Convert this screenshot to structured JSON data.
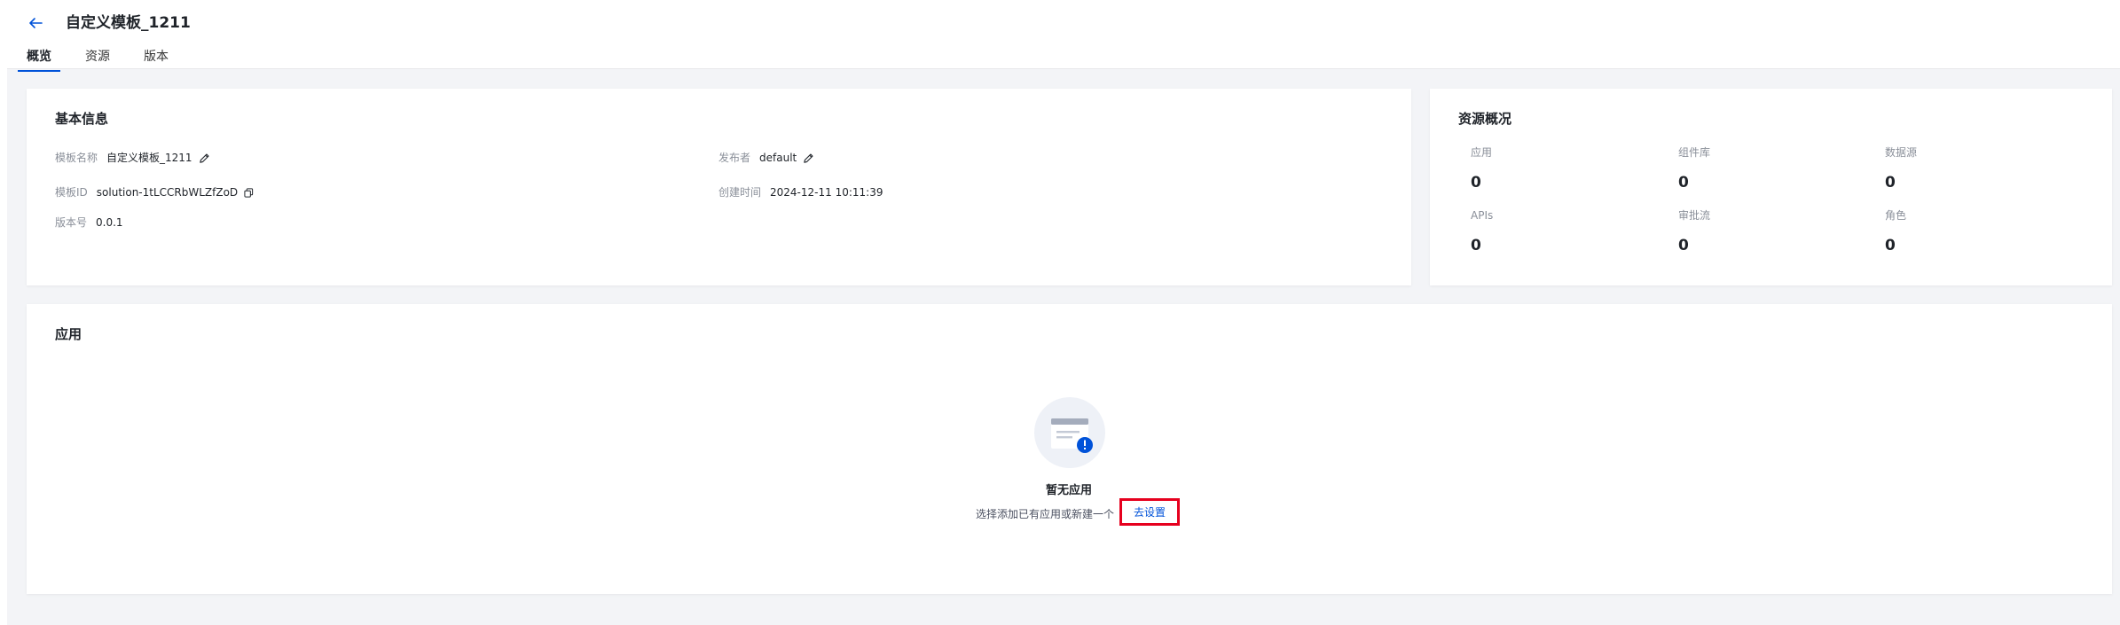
{
  "header": {
    "title": "自定义模板_1211",
    "tabs": [
      {
        "label": "概览"
      },
      {
        "label": "资源"
      },
      {
        "label": "版本"
      }
    ]
  },
  "basic_info": {
    "title": "基本信息",
    "template_name_label": "模板名称",
    "template_name_value": "自定义模板_1211",
    "publisher_label": "发布者",
    "publisher_value": "default",
    "template_id_label": "模板ID",
    "template_id_value": "solution-1tLCCRbWLZfZoD",
    "created_time_label": "创建时间",
    "created_time_value": "2024-12-11 10:11:39",
    "version_label": "版本号",
    "version_value": "0.0.1"
  },
  "resource_overview": {
    "title": "资源概况",
    "stats": [
      {
        "label": "应用",
        "value": "0"
      },
      {
        "label": "组件库",
        "value": "0"
      },
      {
        "label": "数据源",
        "value": "0"
      },
      {
        "label": "APIs",
        "value": "0"
      },
      {
        "label": "审批流",
        "value": "0"
      },
      {
        "label": "角色",
        "value": "0"
      }
    ]
  },
  "apps": {
    "title": "应用",
    "empty_title": "暂无应用",
    "empty_desc": "选择添加已有应用或新建一个",
    "setup_link": "去设置"
  },
  "colors": {
    "accent": "#0052d9",
    "highlight_border": "#e6001e",
    "page_bg": "#f3f4f7"
  }
}
